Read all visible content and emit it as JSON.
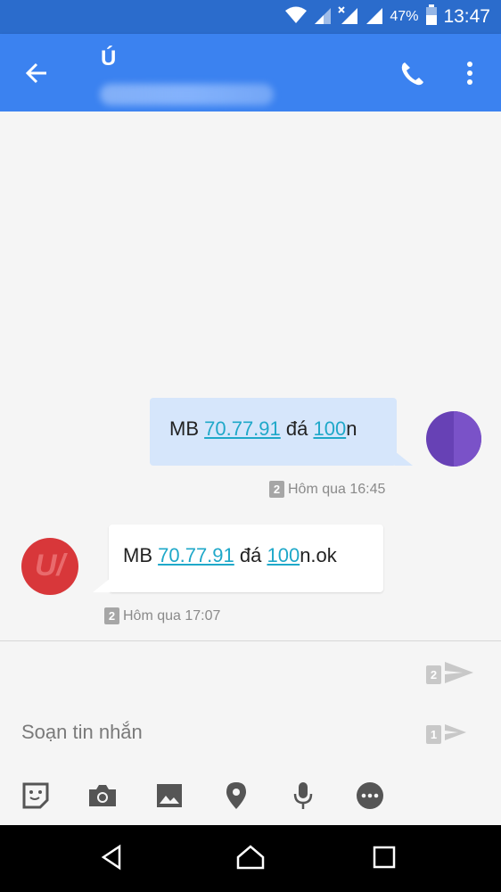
{
  "status_bar": {
    "battery_percent": "47%",
    "time": "13:47",
    "icons": [
      "wifi-icon",
      "signal-icon",
      "signal-x-icon",
      "signal-icon",
      "battery-icon"
    ]
  },
  "app_bar": {
    "contact_initial": "Ú",
    "icons": [
      "back-arrow-icon",
      "phone-icon",
      "more-vert-icon"
    ]
  },
  "messages": [
    {
      "direction": "outgoing",
      "parts": [
        "MB ",
        "70.77.91",
        " đá ",
        "100",
        "n"
      ],
      "sim": "2",
      "time": "Hôm qua 16:45"
    },
    {
      "direction": "incoming",
      "parts": [
        "MB ",
        "70.77.91",
        " đá ",
        "100",
        "n.ok"
      ],
      "sim": "2",
      "time": "Hôm qua 17:07"
    }
  ],
  "compose": {
    "placeholder": "Soạn tin nhắn",
    "send_sim_top": "2",
    "send_sim_bottom": "1",
    "tools": [
      "sticker-icon",
      "camera-icon",
      "image-icon",
      "location-icon",
      "mic-icon",
      "more-horiz-icon"
    ]
  },
  "colors": {
    "status_bar": "#2b6ccc",
    "app_bar": "#3b82f0",
    "outgoing_bubble": "#d6e6fb",
    "link": "#1fa8c9",
    "contact_avatar": "#d8373a",
    "my_avatar": "#6741b5"
  }
}
